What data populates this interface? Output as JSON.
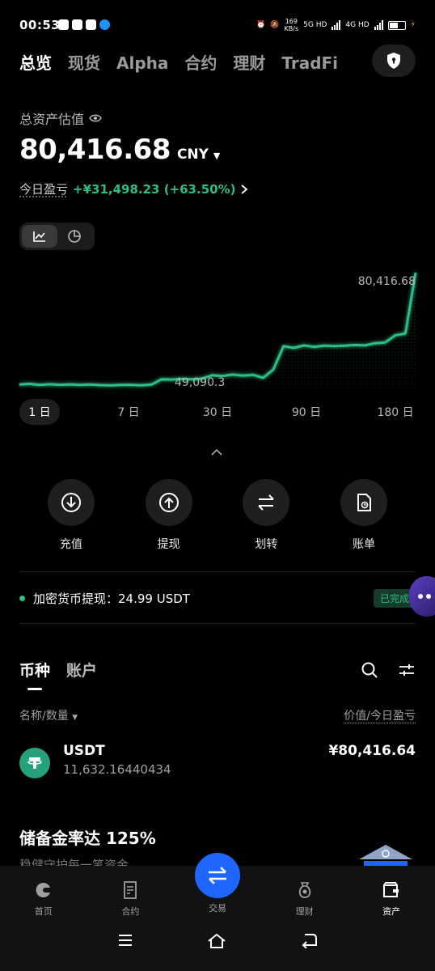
{
  "status_bar": {
    "time": "00:53",
    "speed_value": "169",
    "speed_unit": "KB/s",
    "net1": "5G HD",
    "net2": "4G HD"
  },
  "top_tabs": [
    "总览",
    "现货",
    "Alpha",
    "合约",
    "理财",
    "TradFi"
  ],
  "overview": {
    "estimate_label": "总资产估值",
    "total_value": "80,416.68",
    "currency": "CNY",
    "pnl_label": "今日盈亏",
    "pnl_value": "+¥31,498.23 (+63.50%)"
  },
  "chart_data": {
    "type": "line",
    "title": "",
    "xlabel": "",
    "ylabel": "",
    "x": [
      0,
      1,
      2,
      3,
      4,
      5,
      6,
      7,
      8,
      9,
      10,
      11,
      12,
      13,
      14,
      15,
      16,
      17,
      18,
      19,
      20,
      21,
      22,
      23,
      24,
      25,
      26,
      27,
      28,
      29,
      30,
      31,
      32,
      33,
      34,
      35,
      36,
      37,
      38,
      39
    ],
    "values": [
      49300,
      49500,
      49200,
      49400,
      49250,
      49350,
      49200,
      49300,
      49150,
      49100,
      49200,
      49250,
      49090.3,
      49300,
      50800,
      50700,
      50900,
      50800,
      51000,
      51900,
      51700,
      52100,
      51800,
      52000,
      51200,
      53500,
      60000,
      59500,
      60200,
      59800,
      60100,
      60000,
      60100,
      60300,
      60200,
      60800,
      61000,
      63000,
      63500,
      80416.68
    ],
    "max_label": "80,416.68",
    "min_label": "49,090.3",
    "ylim": [
      46000,
      82000
    ],
    "grid": false,
    "colors": {
      "line": "#2ebd85"
    }
  },
  "ranges": [
    "1 日",
    "7 日",
    "30 日",
    "90 日",
    "180 日"
  ],
  "actions": [
    {
      "label": "充值",
      "icon": "deposit-icon"
    },
    {
      "label": "提现",
      "icon": "withdraw-icon"
    },
    {
      "label": "划转",
      "icon": "transfer-icon"
    },
    {
      "label": "账单",
      "icon": "bill-icon"
    }
  ],
  "notice": {
    "text": "加密货币提现：24.99 USDT",
    "status": "已完成"
  },
  "asset_tabs": [
    "币种",
    "账户"
  ],
  "columns": {
    "left": "名称/数量",
    "right": "价值/今日盈亏"
  },
  "coins": [
    {
      "symbol": "USDT",
      "amount": "11,632.16440434",
      "value": "¥80,416.64"
    }
  ],
  "reserve": {
    "title": "储备金率达 125%",
    "subtitle": "稳健守护每一笔资金"
  },
  "bottom_nav": [
    {
      "label": "首页",
      "icon": "home-icon"
    },
    {
      "label": "合约",
      "icon": "contract-icon"
    },
    {
      "label": "交易",
      "icon": "trade-icon"
    },
    {
      "label": "理财",
      "icon": "earn-icon"
    },
    {
      "label": "资产",
      "icon": "wallet-icon"
    }
  ],
  "colors": {
    "accent_green": "#2ebd85",
    "primary_blue": "#1f66ff"
  }
}
